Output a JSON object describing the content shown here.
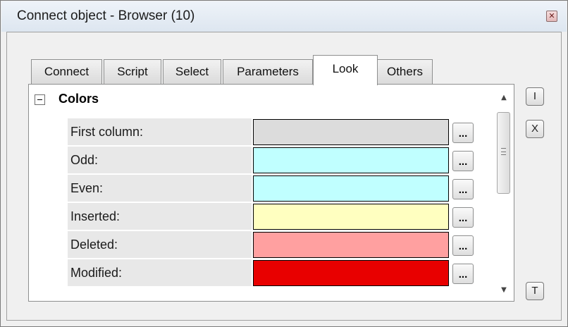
{
  "window": {
    "title": "Connect object - Browser (10)",
    "close_glyph": "✕"
  },
  "tabs": [
    {
      "label": "Connect",
      "active": false
    },
    {
      "label": "Script",
      "active": false
    },
    {
      "label": "Select",
      "active": false
    },
    {
      "label": "Parameters",
      "active": false
    },
    {
      "label": "Look",
      "active": true
    },
    {
      "label": "Others",
      "active": false
    }
  ],
  "section": {
    "toggle": "collapse",
    "title": "Colors"
  },
  "rows": [
    {
      "label": "First column:",
      "color": "#dcdcdc",
      "button": "..."
    },
    {
      "label": "Odd:",
      "color": "#c0ffff",
      "button": "..."
    },
    {
      "label": "Even:",
      "color": "#c0ffff",
      "button": "..."
    },
    {
      "label": "Inserted:",
      "color": "#ffffc0",
      "button": "..."
    },
    {
      "label": "Deleted:",
      "color": "#ffa0a0",
      "button": "..."
    },
    {
      "label": "Modified:",
      "color": "#e80000",
      "button": "..."
    }
  ],
  "side_buttons": {
    "top": "I",
    "second": "X",
    "bottom": "T"
  }
}
